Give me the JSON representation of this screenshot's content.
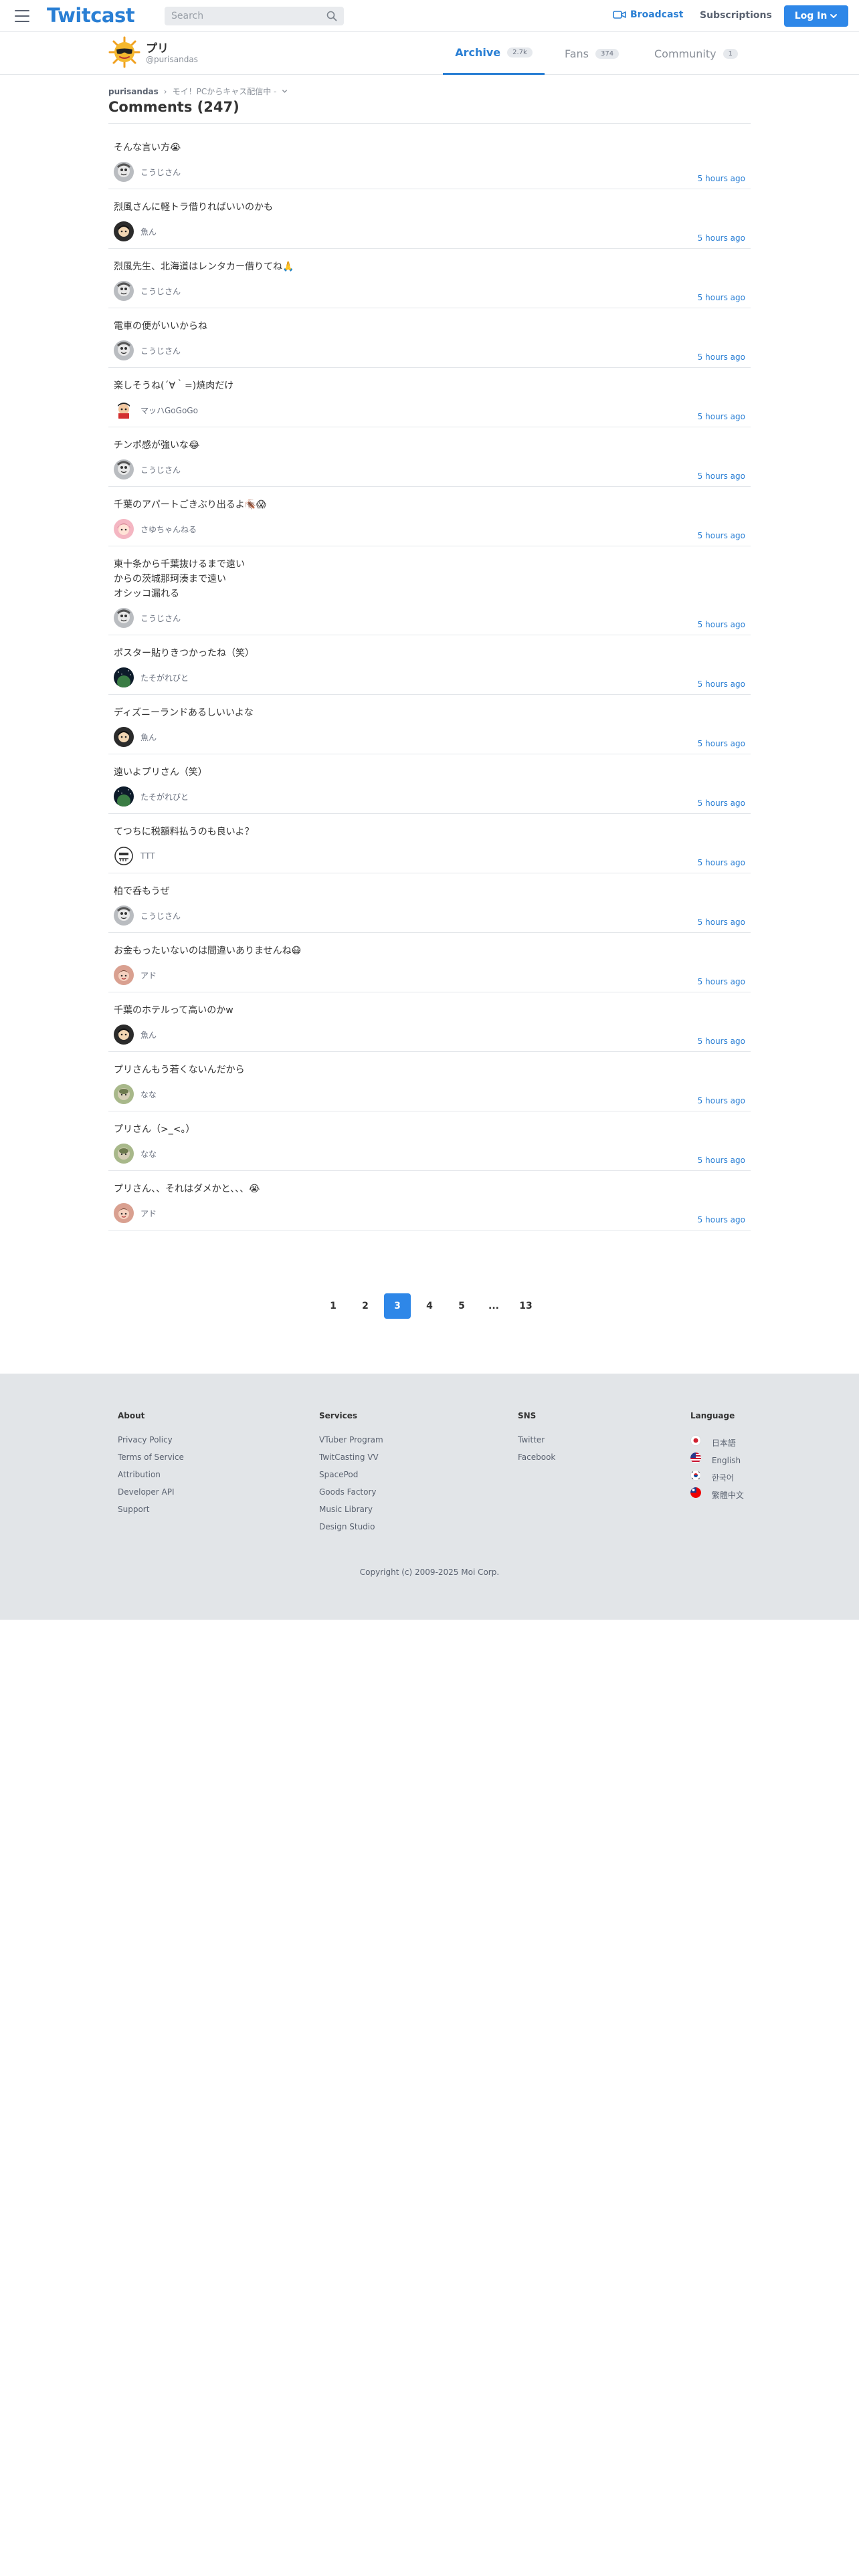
{
  "header": {
    "logo": "Twitcast",
    "search_placeholder": "Search",
    "broadcast_label": "Broadcast",
    "subscriptions_label": "Subscriptions",
    "login_label": "Log In",
    "brand_color": "#2a7fd4"
  },
  "profile": {
    "name": "プリ",
    "handle": "@purisandas",
    "tabs": [
      {
        "label": "Archive",
        "badge": "2.7k",
        "active": true
      },
      {
        "label": "Fans",
        "badge": "374",
        "active": false
      },
      {
        "label": "Community",
        "badge": "1",
        "active": false
      }
    ]
  },
  "breadcrumb": {
    "user": "purisandas",
    "separator": "›",
    "movie": "モイ！PCからキャス配信中 -"
  },
  "page_title": "Comments (247)",
  "comments": [
    {
      "text": "そんな言い方😭",
      "author": "こうじさん",
      "time": "5 hours ago",
      "avatar": "gray"
    },
    {
      "text": "烈風さんに軽トラ借りればいいのかも",
      "author": "魚ん",
      "time": "5 hours ago",
      "avatar": "dark"
    },
    {
      "text": "烈風先生、北海道はレンタカー借りてね🙏",
      "author": "こうじさん",
      "time": "5 hours ago",
      "avatar": "gray"
    },
    {
      "text": "電車の便がいいからね",
      "author": "こうじさん",
      "time": "5 hours ago",
      "avatar": "gray"
    },
    {
      "text": "楽しそうね(´∀｀=)焼肉だけ",
      "author": "マッハGoGoGo",
      "time": "5 hours ago",
      "avatar": "racer"
    },
    {
      "text": "チンポ感が強いな😂",
      "author": "こうじさん",
      "time": "5 hours ago",
      "avatar": "gray"
    },
    {
      "text": "千葉のアパートごきぶり出るよ🪳😱",
      "author": "さゆちゃんねる",
      "time": "5 hours ago",
      "avatar": "pink"
    },
    {
      "text": "東十条から千葉抜けるまで遠い\nからの茨城那珂湊まで遠い\nオシッコ漏れる",
      "author": "こうじさん",
      "time": "5 hours ago",
      "avatar": "gray"
    },
    {
      "text": "ポスター貼りきつかったね（笑）",
      "author": "たそがれびと",
      "time": "5 hours ago",
      "avatar": "space"
    },
    {
      "text": "ディズニーランドあるしいいよな",
      "author": "魚ん",
      "time": "5 hours ago",
      "avatar": "dark"
    },
    {
      "text": "遠いよプリさん（笑）",
      "author": "たそがれびと",
      "time": "5 hours ago",
      "avatar": "space"
    },
    {
      "text": "てつちに税額料払うのも良いよ？",
      "author": "TTT",
      "time": "5 hours ago",
      "avatar": "ttt"
    },
    {
      "text": "柏で呑もうぜ",
      "author": "こうじさん",
      "time": "5 hours ago",
      "avatar": "gray"
    },
    {
      "text": "お金もったいないのは間違いありませんね😷",
      "author": "アド",
      "time": "5 hours ago",
      "avatar": "ado"
    },
    {
      "text": "千葉のホテルって高いのかw",
      "author": "魚ん",
      "time": "5 hours ago",
      "avatar": "dark"
    },
    {
      "text": "プリさんもう若くないんだから",
      "author": "なな",
      "time": "5 hours ago",
      "avatar": "nana"
    },
    {
      "text": "プリさん（>_<。）",
      "author": "なな",
      "time": "5 hours ago",
      "avatar": "nana"
    },
    {
      "text": "プリさん、、それはダメかと、、、😭",
      "author": "アド",
      "time": "5 hours ago",
      "avatar": "ado"
    }
  ],
  "pagination": {
    "pages": [
      "1",
      "2",
      "3",
      "4",
      "5",
      "...",
      "13"
    ],
    "current": "3"
  },
  "footer": {
    "about": {
      "heading": "About",
      "links": [
        "Privacy Policy",
        "Terms of Service",
        "Attribution",
        "Developer API",
        "Support"
      ]
    },
    "services": {
      "heading": "Services",
      "links": [
        "VTuber Program",
        "TwitCasting VV",
        "SpacePod",
        "Goods Factory",
        "Music Library",
        "Design Studio"
      ]
    },
    "sns": {
      "heading": "SNS",
      "links": [
        "Twitter",
        "Facebook"
      ]
    },
    "language": {
      "heading": "Language",
      "links": [
        "日本語",
        "English",
        "한국어",
        "繁體中文"
      ]
    },
    "copyright": "Copyright (c) 2009-2025 Moi Corp."
  }
}
